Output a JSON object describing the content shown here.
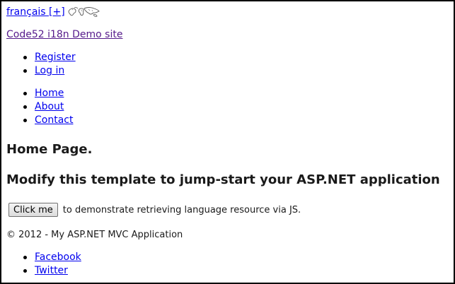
{
  "language_switcher": {
    "link_label": "français [+]",
    "flag_icon": "world-map-icon"
  },
  "site": {
    "title": "Code52 i18n Demo site"
  },
  "account_links": [
    {
      "label": "Register"
    },
    {
      "label": "Log in"
    }
  ],
  "main_menu": [
    {
      "label": "Home"
    },
    {
      "label": "About"
    },
    {
      "label": "Contact"
    }
  ],
  "content": {
    "page_heading": "Home Page.",
    "template_heading": "Modify this template to jump-start your ASP.NET application",
    "button_label": "Click me",
    "demo_text": "to demonstrate retrieving language resource via JS."
  },
  "footer": {
    "copyright": "© 2012 - My ASP.NET MVC Application",
    "social_links": [
      {
        "label": "Facebook"
      },
      {
        "label": "Twitter"
      }
    ]
  },
  "colors": {
    "link": "#0000ee",
    "visited_link": "#551a8b",
    "text": "#1a1a1a",
    "border": "#000000"
  }
}
